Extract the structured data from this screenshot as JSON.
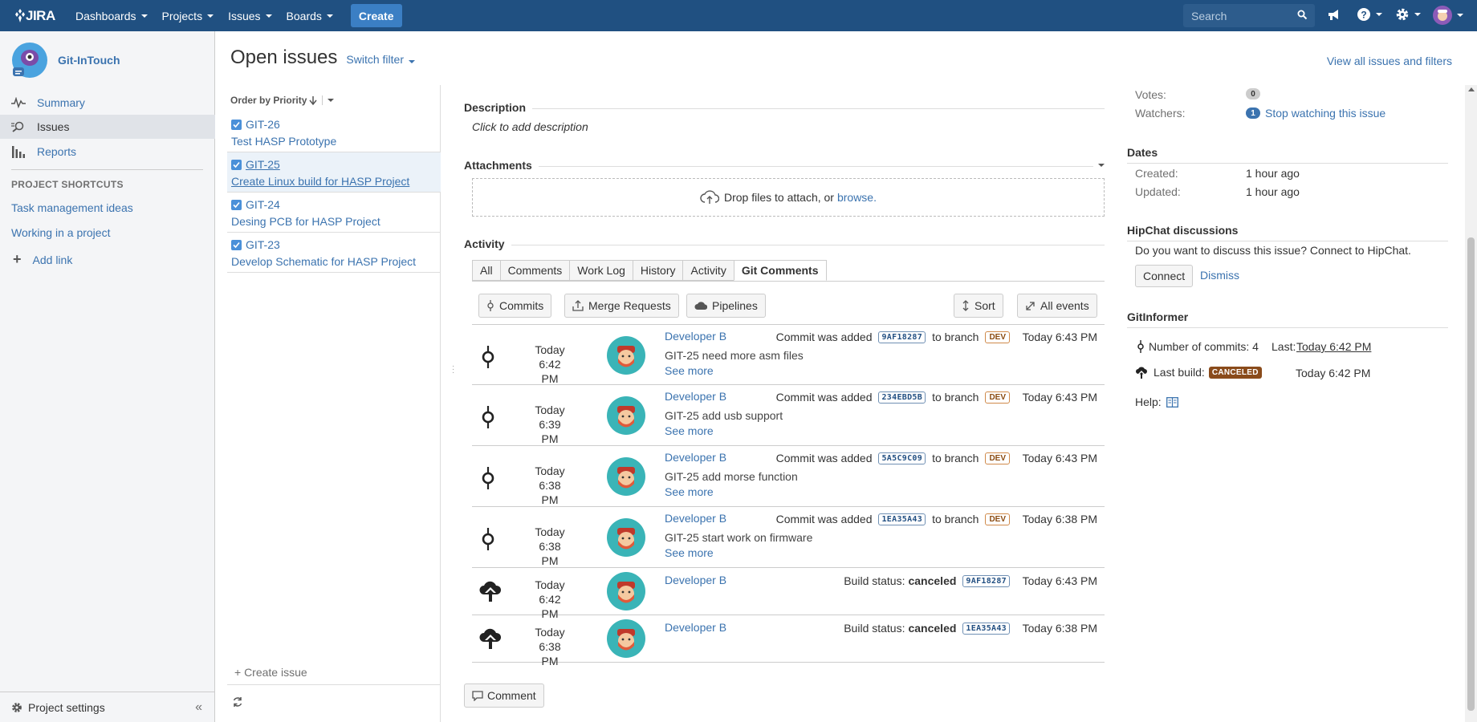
{
  "topnav": {
    "logo": "JIRA",
    "dashboards": "Dashboards",
    "projects": "Projects",
    "issues": "Issues",
    "boards": "Boards",
    "create": "Create",
    "search_placeholder": "Search"
  },
  "sidebar": {
    "project_name": "Git-InTouch",
    "nav": [
      {
        "label": "Summary"
      },
      {
        "label": "Issues"
      },
      {
        "label": "Reports"
      }
    ],
    "shortcuts_heading": "PROJECT SHORTCUTS",
    "shortcuts": [
      "Task management ideas",
      "Working in a project"
    ],
    "add_link": "Add link",
    "settings": "Project settings"
  },
  "header": {
    "title": "Open issues",
    "switch_filter": "Switch filter",
    "view_all": "View all issues and filters"
  },
  "issue_list": {
    "order_by": "Order by Priority",
    "items": [
      {
        "key": "GIT-26",
        "summary": "Test HASP Prototype"
      },
      {
        "key": "GIT-25",
        "summary": "Create Linux build for HASP Project"
      },
      {
        "key": "GIT-24",
        "summary": "Desing PCB for HASP Project"
      },
      {
        "key": "GIT-23",
        "summary": "Develop Schematic for HASP Project"
      }
    ],
    "create_issue": "+ Create issue"
  },
  "detail": {
    "description_heading": "Description",
    "description_placeholder": "Click to add description",
    "attachments_heading": "Attachments",
    "drop_text": "Drop files to attach, or",
    "browse": "browse.",
    "activity_heading": "Activity",
    "tabs": [
      "All",
      "Comments",
      "Work Log",
      "History",
      "Activity",
      "Git Comments"
    ],
    "buttons": {
      "commits": "Commits",
      "merge_requests": "Merge Requests",
      "pipelines": "Pipelines",
      "sort": "Sort",
      "all_events": "All events"
    },
    "rows": [
      {
        "type": "commit",
        "time_line1": "Today 6:42",
        "time_line2": "PM",
        "author": "Developer B",
        "action": "Commit was added",
        "hash": "9AF18287",
        "to_branch": "to branch",
        "branch": "DEV",
        "when": "Today 6:43 PM",
        "message": "GIT-25 need more asm files",
        "see_more": "See more"
      },
      {
        "type": "commit",
        "time_line1": "Today 6:39",
        "time_line2": "PM",
        "author": "Developer B",
        "action": "Commit was added",
        "hash": "234EBD5B",
        "to_branch": "to branch",
        "branch": "DEV",
        "when": "Today 6:43 PM",
        "message": "GIT-25 add usb support",
        "see_more": "See more"
      },
      {
        "type": "commit",
        "time_line1": "Today 6:38",
        "time_line2": "PM",
        "author": "Developer B",
        "action": "Commit was added",
        "hash": "5A5C9C09",
        "to_branch": "to branch",
        "branch": "DEV",
        "when": "Today 6:43 PM",
        "message": "GIT-25 add morse function",
        "see_more": "See more"
      },
      {
        "type": "commit",
        "time_line1": "Today 6:38",
        "time_line2": "PM",
        "author": "Developer B",
        "action": "Commit was added",
        "hash": "1EA35A43",
        "to_branch": "to branch",
        "branch": "DEV",
        "when": "Today 6:38 PM",
        "message": "GIT-25 start work on firmware",
        "see_more": "See more"
      },
      {
        "type": "build",
        "time_line1": "Today 6:42",
        "time_line2": "PM",
        "author": "Developer B",
        "build_label": "Build status:",
        "status": "canceled",
        "hash": "9AF18287",
        "when": "Today 6:43 PM"
      },
      {
        "type": "build",
        "time_line1": "Today 6:38",
        "time_line2": "PM",
        "author": "Developer B",
        "build_label": "Build status:",
        "status": "canceled",
        "hash": "1EA35A43",
        "when": "Today 6:38 PM"
      }
    ],
    "comment": "Comment"
  },
  "right": {
    "votes_label": "Votes:",
    "votes_count": "0",
    "watchers_label": "Watchers:",
    "watchers_count": "1",
    "stop_watching": "Stop watching this issue",
    "dates_heading": "Dates",
    "created_label": "Created:",
    "created": "1 hour ago",
    "updated_label": "Updated:",
    "updated": "1 hour ago",
    "hipchat_heading": "HipChat discussions",
    "hipchat_text": "Do you want to discuss this issue? Connect to HipChat.",
    "connect": "Connect",
    "dismiss": "Dismiss",
    "gitinformer_heading": "GitInformer",
    "commits_label": "Number of commits: 4",
    "last_label": "Last:",
    "last_value": "Today 6:42 PM",
    "build_label": "Last build:",
    "build_status": "CANCELED",
    "build_time": "Today 6:42 PM",
    "help_label": "Help:"
  },
  "colors": {
    "topnav": "#205081",
    "link": "#3b73af",
    "create": "#3b7fc4",
    "canceled": "#8a4b1b"
  }
}
